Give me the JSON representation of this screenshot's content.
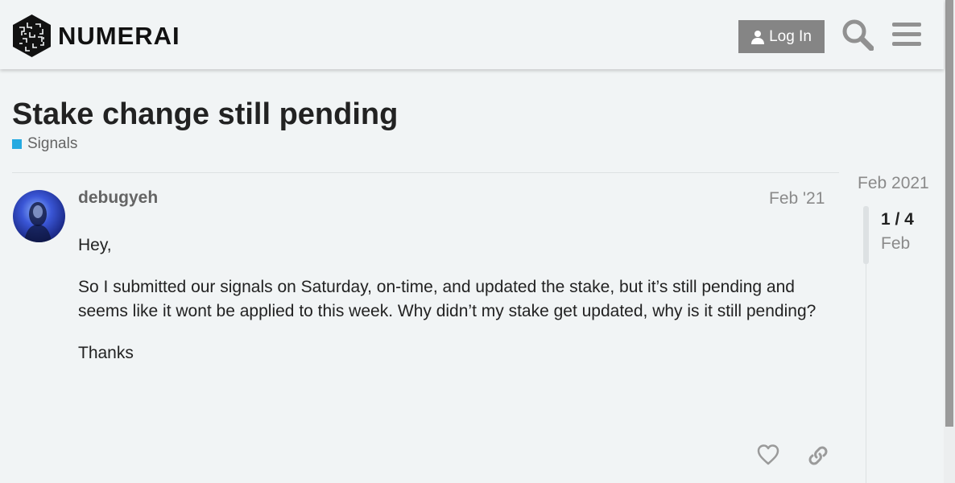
{
  "header": {
    "logo_text": "NUMERAI",
    "login_label": "Log In",
    "icons": {
      "user": "user-icon",
      "search": "search-icon",
      "menu": "hamburger-menu-icon"
    }
  },
  "topic": {
    "title": "Stake change still pending",
    "category": {
      "label": "Signals",
      "color": "#25aae1"
    }
  },
  "post": {
    "username": "debugyeh",
    "date": "Feb '21",
    "paragraphs": [
      "Hey,",
      "So I submitted our signals on Saturday, on-time, and updated the stake, but it’s still pending and seems like it wont be applied to this week. Why didn’t my stake get updated, why is it still pending?",
      "Thanks"
    ],
    "actions": {
      "like": "heart-icon",
      "link": "link-icon"
    }
  },
  "timeline": {
    "start_label": "Feb 2021",
    "position": "1 / 4",
    "current_date": "Feb"
  }
}
